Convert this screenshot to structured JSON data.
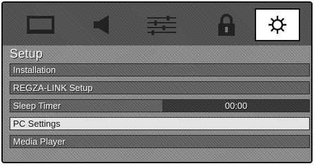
{
  "tabs": [
    {
      "icon": "picture-icon",
      "selected": false
    },
    {
      "icon": "speaker-icon",
      "selected": false
    },
    {
      "icon": "sliders-icon",
      "selected": false
    },
    {
      "icon": "lock-icon",
      "selected": false
    },
    {
      "icon": "gear-icon",
      "selected": true
    }
  ],
  "menu": {
    "title": "Setup",
    "items": [
      {
        "label": "Installation",
        "value": null,
        "selected": false
      },
      {
        "label": "REGZA-LINK Setup",
        "value": null,
        "selected": false
      },
      {
        "label": "Sleep Timer",
        "value": "00:00",
        "selected": false
      },
      {
        "label": "PC Settings",
        "value": null,
        "selected": true
      },
      {
        "label": "Media Player",
        "value": null,
        "selected": false
      }
    ]
  },
  "colors": {
    "background": "#8f8f8f",
    "topbar": "#585858",
    "selected_row": "#e4e4e4",
    "text": "#ffffff"
  }
}
